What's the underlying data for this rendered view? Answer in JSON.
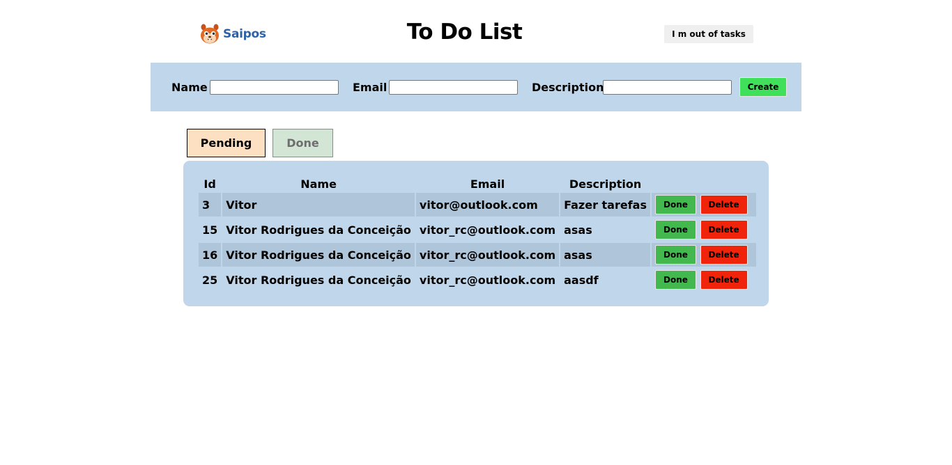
{
  "header": {
    "logo_text": "Saipos",
    "title": "To Do List",
    "out_of_tasks_label": "I m out of tasks"
  },
  "form": {
    "name_label": "Name",
    "email_label": "Email",
    "description_label": "Description",
    "name_value": "",
    "email_value": "",
    "description_value": "",
    "create_label": "Create"
  },
  "tabs": [
    {
      "label": "Pending",
      "active": true
    },
    {
      "label": "Done",
      "active": false
    }
  ],
  "table": {
    "headers": [
      "Id",
      "Name",
      "Email",
      "Description",
      ""
    ],
    "rows": [
      {
        "id": "3",
        "name": "Vitor",
        "email": "vitor@outlook.com",
        "description": "Fazer tarefas"
      },
      {
        "id": "15",
        "name": "Vitor Rodrigues da Conceição",
        "email": "vitor_rc@outlook.com",
        "description": "asas"
      },
      {
        "id": "16",
        "name": "Vitor Rodrigues da Conceição",
        "email": "vitor_rc@outlook.com",
        "description": "asas"
      },
      {
        "id": "25",
        "name": "Vitor Rodrigues da Conceição",
        "email": "vitor_rc@outlook.com",
        "description": "aasdf"
      }
    ],
    "done_label": "Done",
    "delete_label": "Delete"
  },
  "colors": {
    "form_bar_bg": "#c0d6ea",
    "panel_bg": "#c0d6ea",
    "row_shade": "#afc5da",
    "create_btn": "#40e05a",
    "done_btn": "#43b84e",
    "delete_btn": "#f0230b",
    "tab_pending_bg": "#fde0c2",
    "tab_done_bg": "#d3e6d5",
    "logo_blue": "#2e62a8"
  },
  "icons": {
    "logo": "squirrel-mascot-icon"
  }
}
